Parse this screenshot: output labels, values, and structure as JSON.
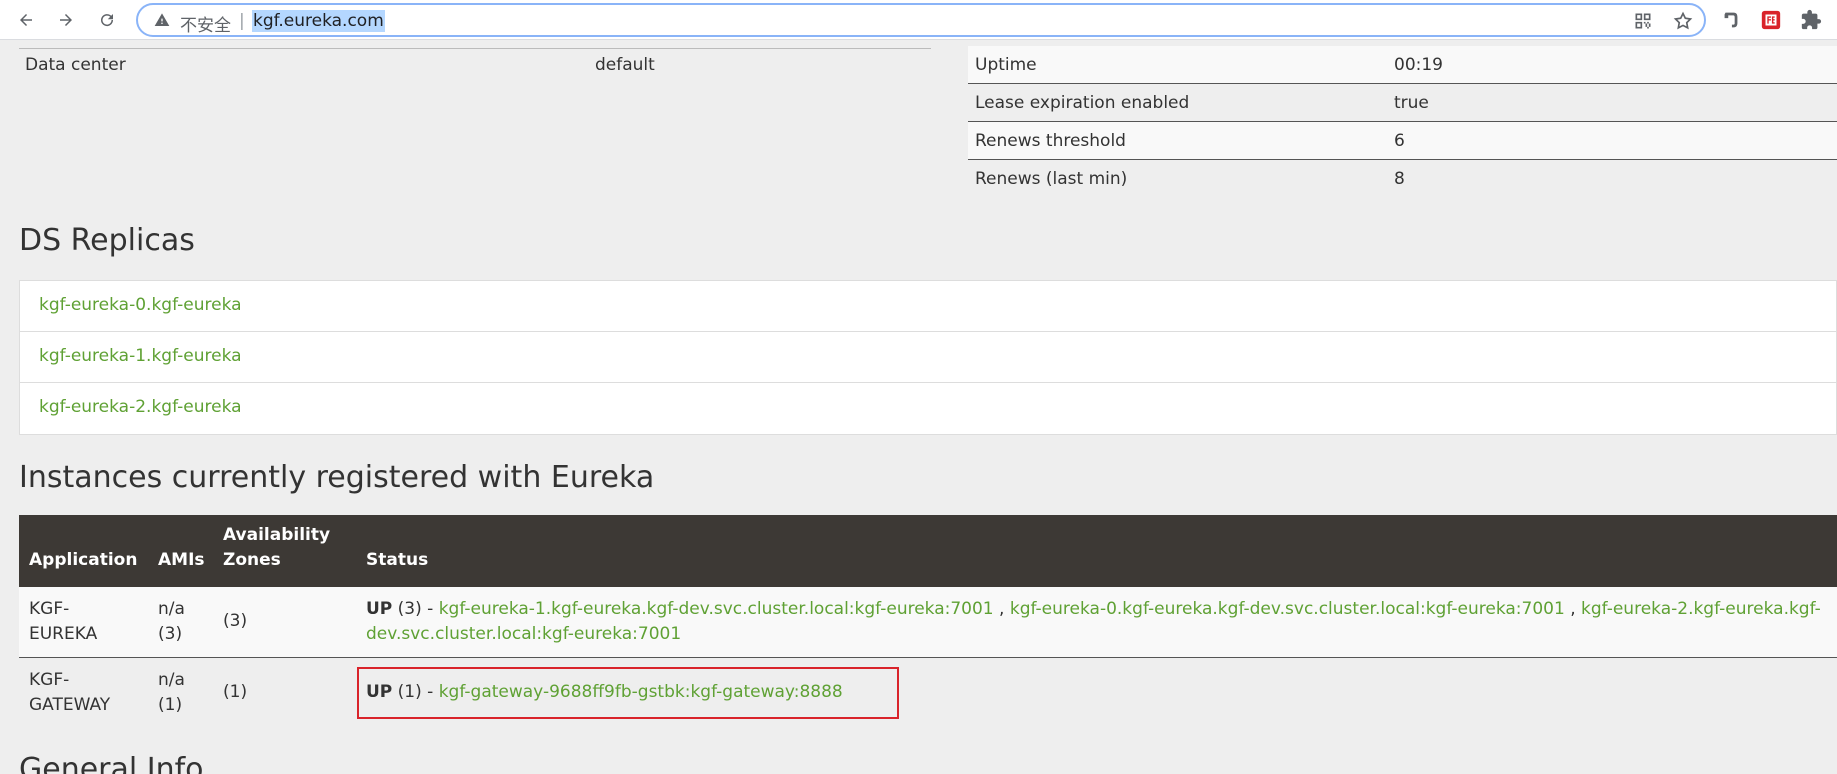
{
  "browser": {
    "security_label": "不安全",
    "separator": "|",
    "url": "kgf.eureka.com"
  },
  "info_left": {
    "key": "Data center",
    "value": "default"
  },
  "info_right": [
    {
      "key": "Uptime",
      "value": "00:19"
    },
    {
      "key": "Lease expiration enabled",
      "value": "true"
    },
    {
      "key": "Renews threshold",
      "value": "6"
    },
    {
      "key": "Renews (last min)",
      "value": "8"
    }
  ],
  "ds_replicas": {
    "title": "DS Replicas",
    "items": [
      "kgf-eureka-0.kgf-eureka",
      "kgf-eureka-1.kgf-eureka",
      "kgf-eureka-2.kgf-eureka"
    ]
  },
  "instances": {
    "title": "Instances currently registered with Eureka",
    "headers": {
      "application": "Application",
      "amis": "AMIs",
      "zones_1": "Availability",
      "zones_2": "Zones",
      "status": "Status"
    },
    "rows": [
      {
        "app_1": "KGF-",
        "app_2": "EUREKA",
        "ami_1": "n/a",
        "ami_2": "(3)",
        "zones": "(3)",
        "status_state": "UP",
        "status_count": " (3) - ",
        "link_1": "kgf-eureka-1.kgf-eureka.kgf-dev.svc.cluster.local:kgf-eureka:7001",
        "link_2": "kgf-eureka-0.kgf-eureka.kgf-dev.svc.cluster.local:kgf-eureka:7001",
        "link_3a": "kgf-eureka-2.kgf-eureka.kgf-",
        "link_3b": "dev.svc.cluster.local:kgf-eureka:7001",
        "comma": " , "
      },
      {
        "app_1": "KGF-",
        "app_2": "GATEWAY",
        "ami_1": "n/a",
        "ami_2": "(1)",
        "zones": "(1)",
        "status_state": "UP",
        "status_count": " (1) - ",
        "link_1": "kgf-gateway-9688ff9fb-gstbk:kgf-gateway:8888"
      }
    ]
  },
  "general_info": {
    "title": "General Info"
  },
  "colors": {
    "link": "#5fa134",
    "table_header": "#3d3935",
    "highlight": "#d9232a"
  }
}
